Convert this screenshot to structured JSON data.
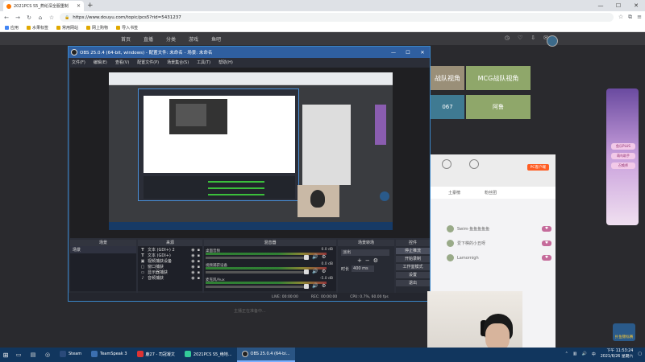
{
  "browser": {
    "tab_title": "2021PCS S5_燕纶深全服重制",
    "url": "https://www.douyu.com/topic/pcs5?rid=5431237",
    "bookmarks": [
      "应用",
      "水果标签",
      "常用网站",
      "网上购物",
      "导入书签"
    ]
  },
  "douyu": {
    "nav": [
      "首页",
      "直播",
      "分类",
      "游戏",
      "鱼吧"
    ],
    "team_tiles": [
      {
        "label": "战队视角"
      },
      {
        "label": "MCG战队视角"
      },
      {
        "label": "067"
      },
      {
        "label": "阿鲁"
      }
    ],
    "gift_button": "PC客户端",
    "chat_tabs": [
      "土豪榜",
      "粉丝团"
    ],
    "chat_rows": [
      {
        "name": "Swim·鱼鱼鱼鱼鱼",
        "badge": ""
      },
      {
        "name": "爱下棋的小丑呀",
        "badge": ""
      },
      {
        "name": "Lamornigh",
        "badge": ""
      }
    ],
    "promo_buttons": [
      "鱼乐PLUS",
      "萌鸟助手",
      "召唤师"
    ],
    "anchor_label": "扑鱼锦标赛",
    "hint_text": "主播正在准备中..."
  },
  "obs": {
    "title": "OBS 25.0.4 (64-bit, windows) - 配置文件: 未命名 - 场景: 未命名",
    "menu": [
      "文件(F)",
      "编辑(E)",
      "查看(V)",
      "配置文件(P)",
      "场景集合(S)",
      "工具(T)",
      "帮助(H)"
    ],
    "docks": {
      "scenes": {
        "title": "场景",
        "items": [
          "场景"
        ]
      },
      "sources": {
        "title": "来源",
        "items": [
          {
            "icon": "T",
            "name": "文本 (GDI+) 2"
          },
          {
            "icon": "T",
            "name": "文本 (GDI+)"
          },
          {
            "icon": "▣",
            "name": "视频捕获设备"
          },
          {
            "icon": "▢",
            "name": "窗口捕获"
          },
          {
            "icon": "▭",
            "name": "显示器捕获"
          },
          {
            "icon": "♪",
            "name": "音频捕获"
          }
        ]
      },
      "mixer": {
        "title": "混音器",
        "channels": [
          {
            "name": "桌面音频",
            "db": "0.0 dB"
          },
          {
            "name": "视频捕获设备",
            "db": "0.0 dB"
          },
          {
            "name": "麦克风/Aux",
            "db": "-5.0 dB"
          }
        ]
      },
      "transitions": {
        "title": "场景转场",
        "selected": "淡出",
        "duration_label": "时长",
        "duration": "400 ms"
      },
      "controls": {
        "title": "控件",
        "buttons": [
          "停止推流",
          "开始录制",
          "工作室模式",
          "设置",
          "退出"
        ]
      }
    },
    "status": {
      "live": "LIVE: 00:00:00",
      "rec": "REC: 00:00:00",
      "cpu": "CPU: 0.7%, 60.00 fps"
    }
  },
  "taskbar": {
    "apps": [
      {
        "label": "Steam",
        "active": false
      },
      {
        "label": "TeamSpeak 3",
        "active": false
      },
      {
        "label": "鹿27 - 司冠凝文",
        "active": false
      },
      {
        "label": "2021PCS S5_绝地...",
        "active": false
      },
      {
        "label": "OBS 25.0.4 (64-bi...",
        "active": true
      }
    ],
    "time": "11:53:24",
    "time_prefix": "下午",
    "date": "2021/6/26 星期六"
  }
}
